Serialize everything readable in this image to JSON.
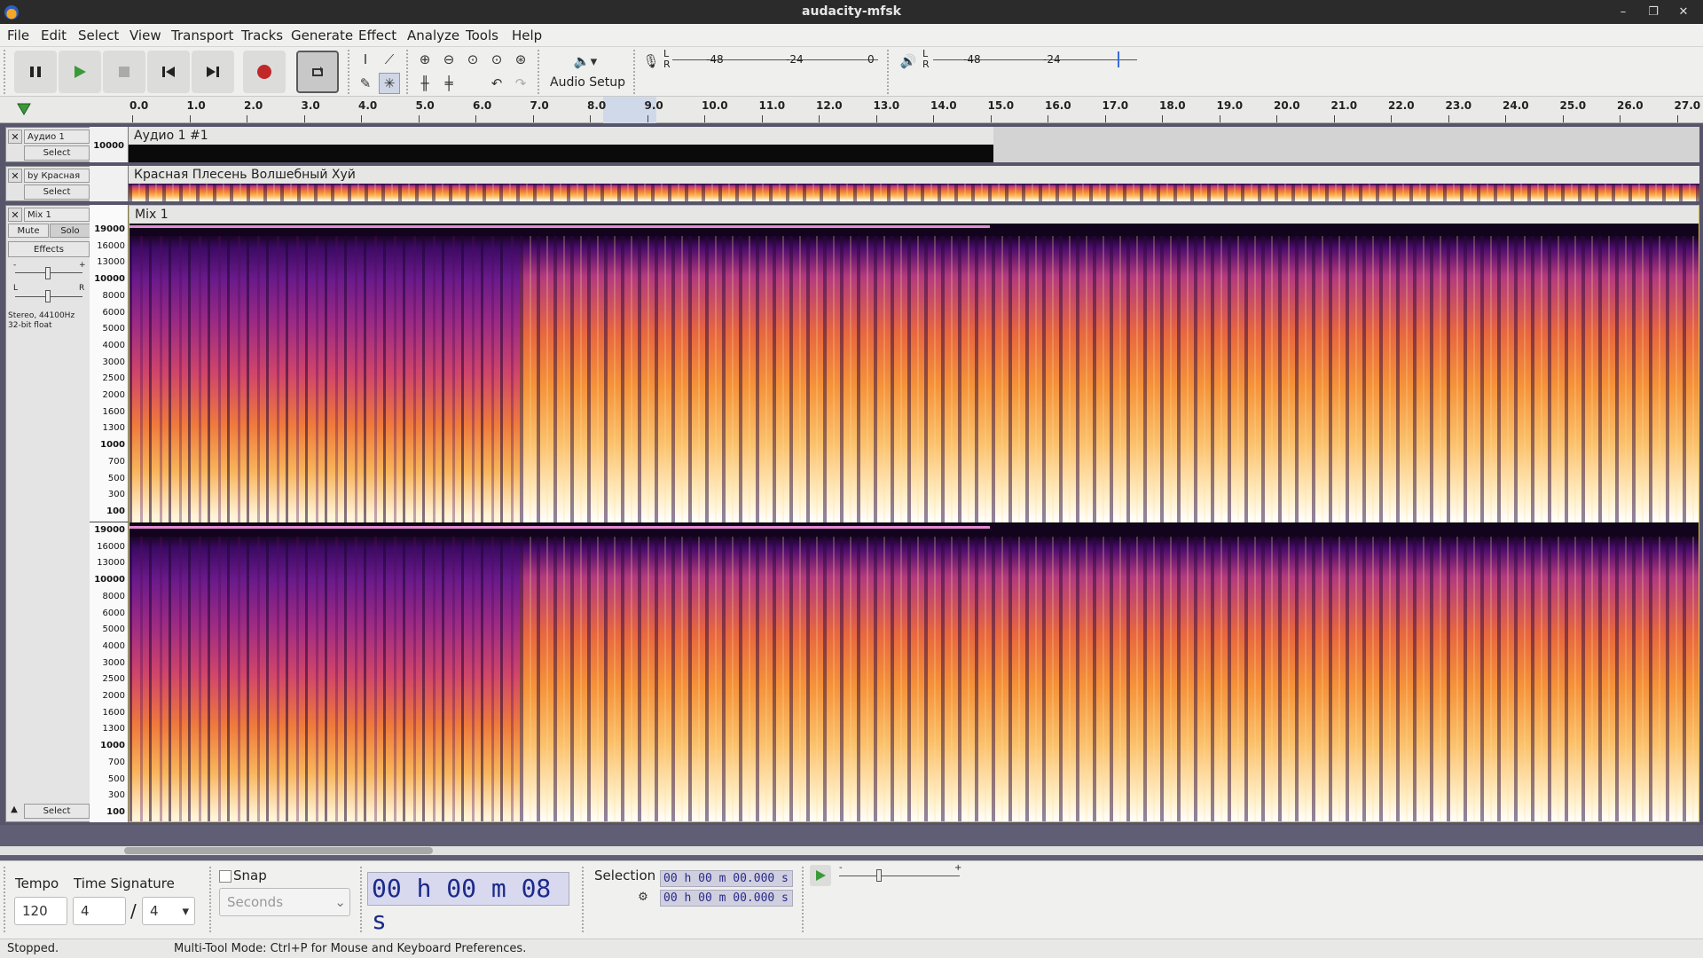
{
  "window": {
    "title": "audacity-mfsk"
  },
  "menu": [
    "File",
    "Edit",
    "Select",
    "View",
    "Transport",
    "Tracks",
    "Generate",
    "Effect",
    "Analyze",
    "Tools",
    "Help"
  ],
  "toolbar": {
    "audio_setup_label": "Audio Setup",
    "rec_meter_labels": [
      "-48",
      "-24",
      "0"
    ],
    "play_meter_labels": [
      "-48",
      "-24"
    ],
    "meter_lr_left": "L",
    "meter_lr_right": "R"
  },
  "ruler": {
    "ticks": [
      "0.0",
      "1.0",
      "2.0",
      "3.0",
      "4.0",
      "5.0",
      "6.0",
      "7.0",
      "8.0",
      "9.0",
      "10.0",
      "11.0",
      "12.0",
      "13.0",
      "14.0",
      "15.0",
      "16.0",
      "17.0",
      "18.0",
      "19.0",
      "20.0",
      "21.0",
      "22.0",
      "23.0",
      "24.0",
      "25.0",
      "26.0",
      "27.0"
    ]
  },
  "tracks": [
    {
      "name": "Аудио 1",
      "clip_title": "Аудио 1 #1",
      "select_label": "Select",
      "scale_label": "10000"
    },
    {
      "name": "by Красная",
      "clip_title": "Красная Плесень Волшебный Хуй",
      "select_label": "Select"
    },
    {
      "name": "Mix 1",
      "clip_title": "Mix 1",
      "mute_label": "Mute",
      "solo_label": "Solo",
      "effects_label": "Effects",
      "gain_min": "-",
      "gain_max": "+",
      "pan_left": "L",
      "pan_right": "R",
      "info_line1": "Stereo, 44100Hz",
      "info_line2": "32-bit float",
      "select_label": "Select",
      "freq_scale": [
        "19000",
        "16000",
        "13000",
        "10000",
        "8000",
        "6000",
        "5000",
        "4000",
        "3000",
        "2500",
        "2000",
        "1600",
        "1300",
        "1000",
        "700",
        "500",
        "300",
        "100"
      ]
    }
  ],
  "bottom": {
    "tempo_label": "Tempo",
    "tempo_value": "120",
    "timesig_label": "Time Signature",
    "timesig_num": "4",
    "timesig_sep": "/",
    "timesig_den": "4",
    "snap_label": "Snap",
    "snap_unit": "Seconds",
    "time_display": "00 h 00 m 08 s",
    "selection_label": "Selection",
    "sel_start": "00 h 00 m 00.000 s",
    "sel_end": "00 h 00 m 00.000 s"
  },
  "status": {
    "state": "Stopped.",
    "hint": "Multi-Tool Mode: Ctrl+P for Mouse and Keyboard Preferences."
  },
  "colors": {
    "accent": "#3a6bd8",
    "record": "#c0282a",
    "play": "#3a9a3a"
  }
}
